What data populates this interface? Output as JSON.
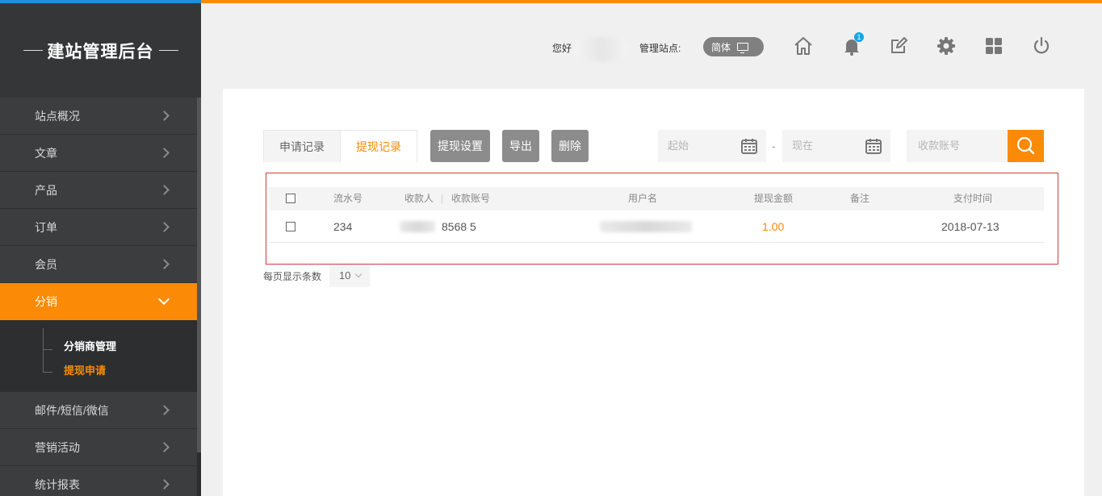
{
  "brand": {
    "title": "建站管理后台"
  },
  "sidebar": {
    "items": [
      {
        "label": "站点概况"
      },
      {
        "label": "文章"
      },
      {
        "label": "产品"
      },
      {
        "label": "订单"
      },
      {
        "label": "会员"
      },
      {
        "label": "分销",
        "active": true
      },
      {
        "label": "邮件/短信/微信"
      },
      {
        "label": "营销活动"
      },
      {
        "label": "统计报表"
      }
    ],
    "submenu": [
      {
        "label": "分销商管理"
      },
      {
        "label": "提现申请",
        "current": true
      }
    ]
  },
  "header": {
    "greeting": "您好",
    "site_label": "管理站点:",
    "language": "简体",
    "notification_count": "1",
    "icons": [
      "home-icon",
      "bell-icon",
      "edit-icon",
      "gear-icon",
      "grid-icon",
      "power-icon"
    ]
  },
  "tabs": [
    {
      "label": "申请记录"
    },
    {
      "label": "提现记录",
      "active": true
    }
  ],
  "toolbar": {
    "settings_label": "提现设置",
    "export_label": "导出",
    "delete_label": "删除"
  },
  "filters": {
    "start_placeholder": "起始",
    "end_placeholder": "现在",
    "date_separator": "-",
    "account_placeholder": "收款账号"
  },
  "table": {
    "headers": {
      "serial": "流水号",
      "payee": "收款人",
      "divider": "|",
      "account": "收款账号",
      "username": "用户名",
      "amount": "提现金额",
      "remark": "备注",
      "pay_time": "支付时间"
    },
    "rows": [
      {
        "serial": "234",
        "account": "8568 5",
        "amount": "1.00",
        "remark": "",
        "pay_time": "2018-07-13"
      }
    ]
  },
  "pagination": {
    "page_size_label": "每页显示条数",
    "page_size": "10"
  },
  "colors": {
    "accent": "#fb8a06",
    "sidebar_bg": "#3b3d3e",
    "button_gray": "#8c8c8c",
    "frame_red": "#d9373a"
  }
}
